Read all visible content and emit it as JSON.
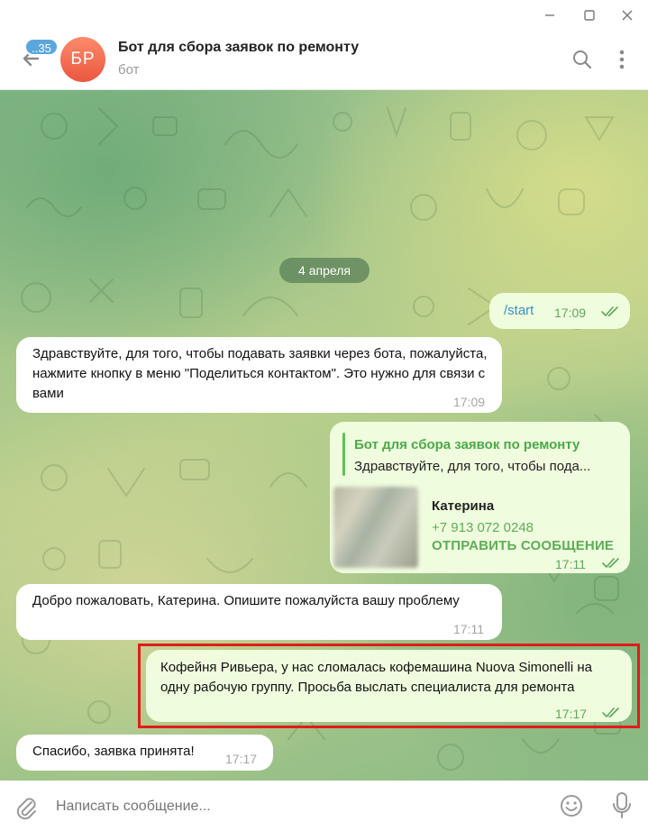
{
  "header": {
    "unread_count": "..35",
    "avatar_initials": "БР",
    "title": "Бот для сбора заявок по ремонту",
    "subtitle": "бот"
  },
  "date_separator": "4 апреля",
  "messages": [
    {
      "direction": "out",
      "text": "/start",
      "time": "17:09",
      "status": "read"
    },
    {
      "direction": "in",
      "text": "Здравствуйте, для того, чтобы подавать заявки через бота, пожалуйста, нажмите кнопку в меню \"Поделиться контактом\". Это нужно для связи с вами",
      "time": "17:09"
    },
    {
      "direction": "out",
      "type": "contact",
      "reply_to": {
        "sender": "Бот для сбора заявок по ремонту",
        "text": "Здравствуйте, для того, чтобы пода..."
      },
      "contact": {
        "name": "Катерина",
        "phone": "+7 913 072 0248",
        "action": "ОТПРАВИТЬ СООБЩЕНИЕ"
      },
      "time": "17:11",
      "status": "read"
    },
    {
      "direction": "in",
      "text": "Добро пожаловать, Катерина. Опишите пожалуйста вашу проблему",
      "time": "17:11"
    },
    {
      "direction": "out",
      "text": "Кофейня Ривьера, у нас сломалась кофемашина Nuova Simonelli на одну рабочую группу. Просьба выслать специалиста для ремонта",
      "time": "17:17",
      "status": "read",
      "highlighted": true
    },
    {
      "direction": "in",
      "text": "Спасибо, заявка принята!",
      "time": "17:17"
    }
  ],
  "composer": {
    "placeholder": "Написать сообщение..."
  },
  "colors": {
    "accent": "#5aa7de",
    "outgoing_bubble": "#effdde",
    "incoming_bubble": "#ffffff",
    "highlight": "#e21b1b",
    "avatar": "#e9573f"
  }
}
